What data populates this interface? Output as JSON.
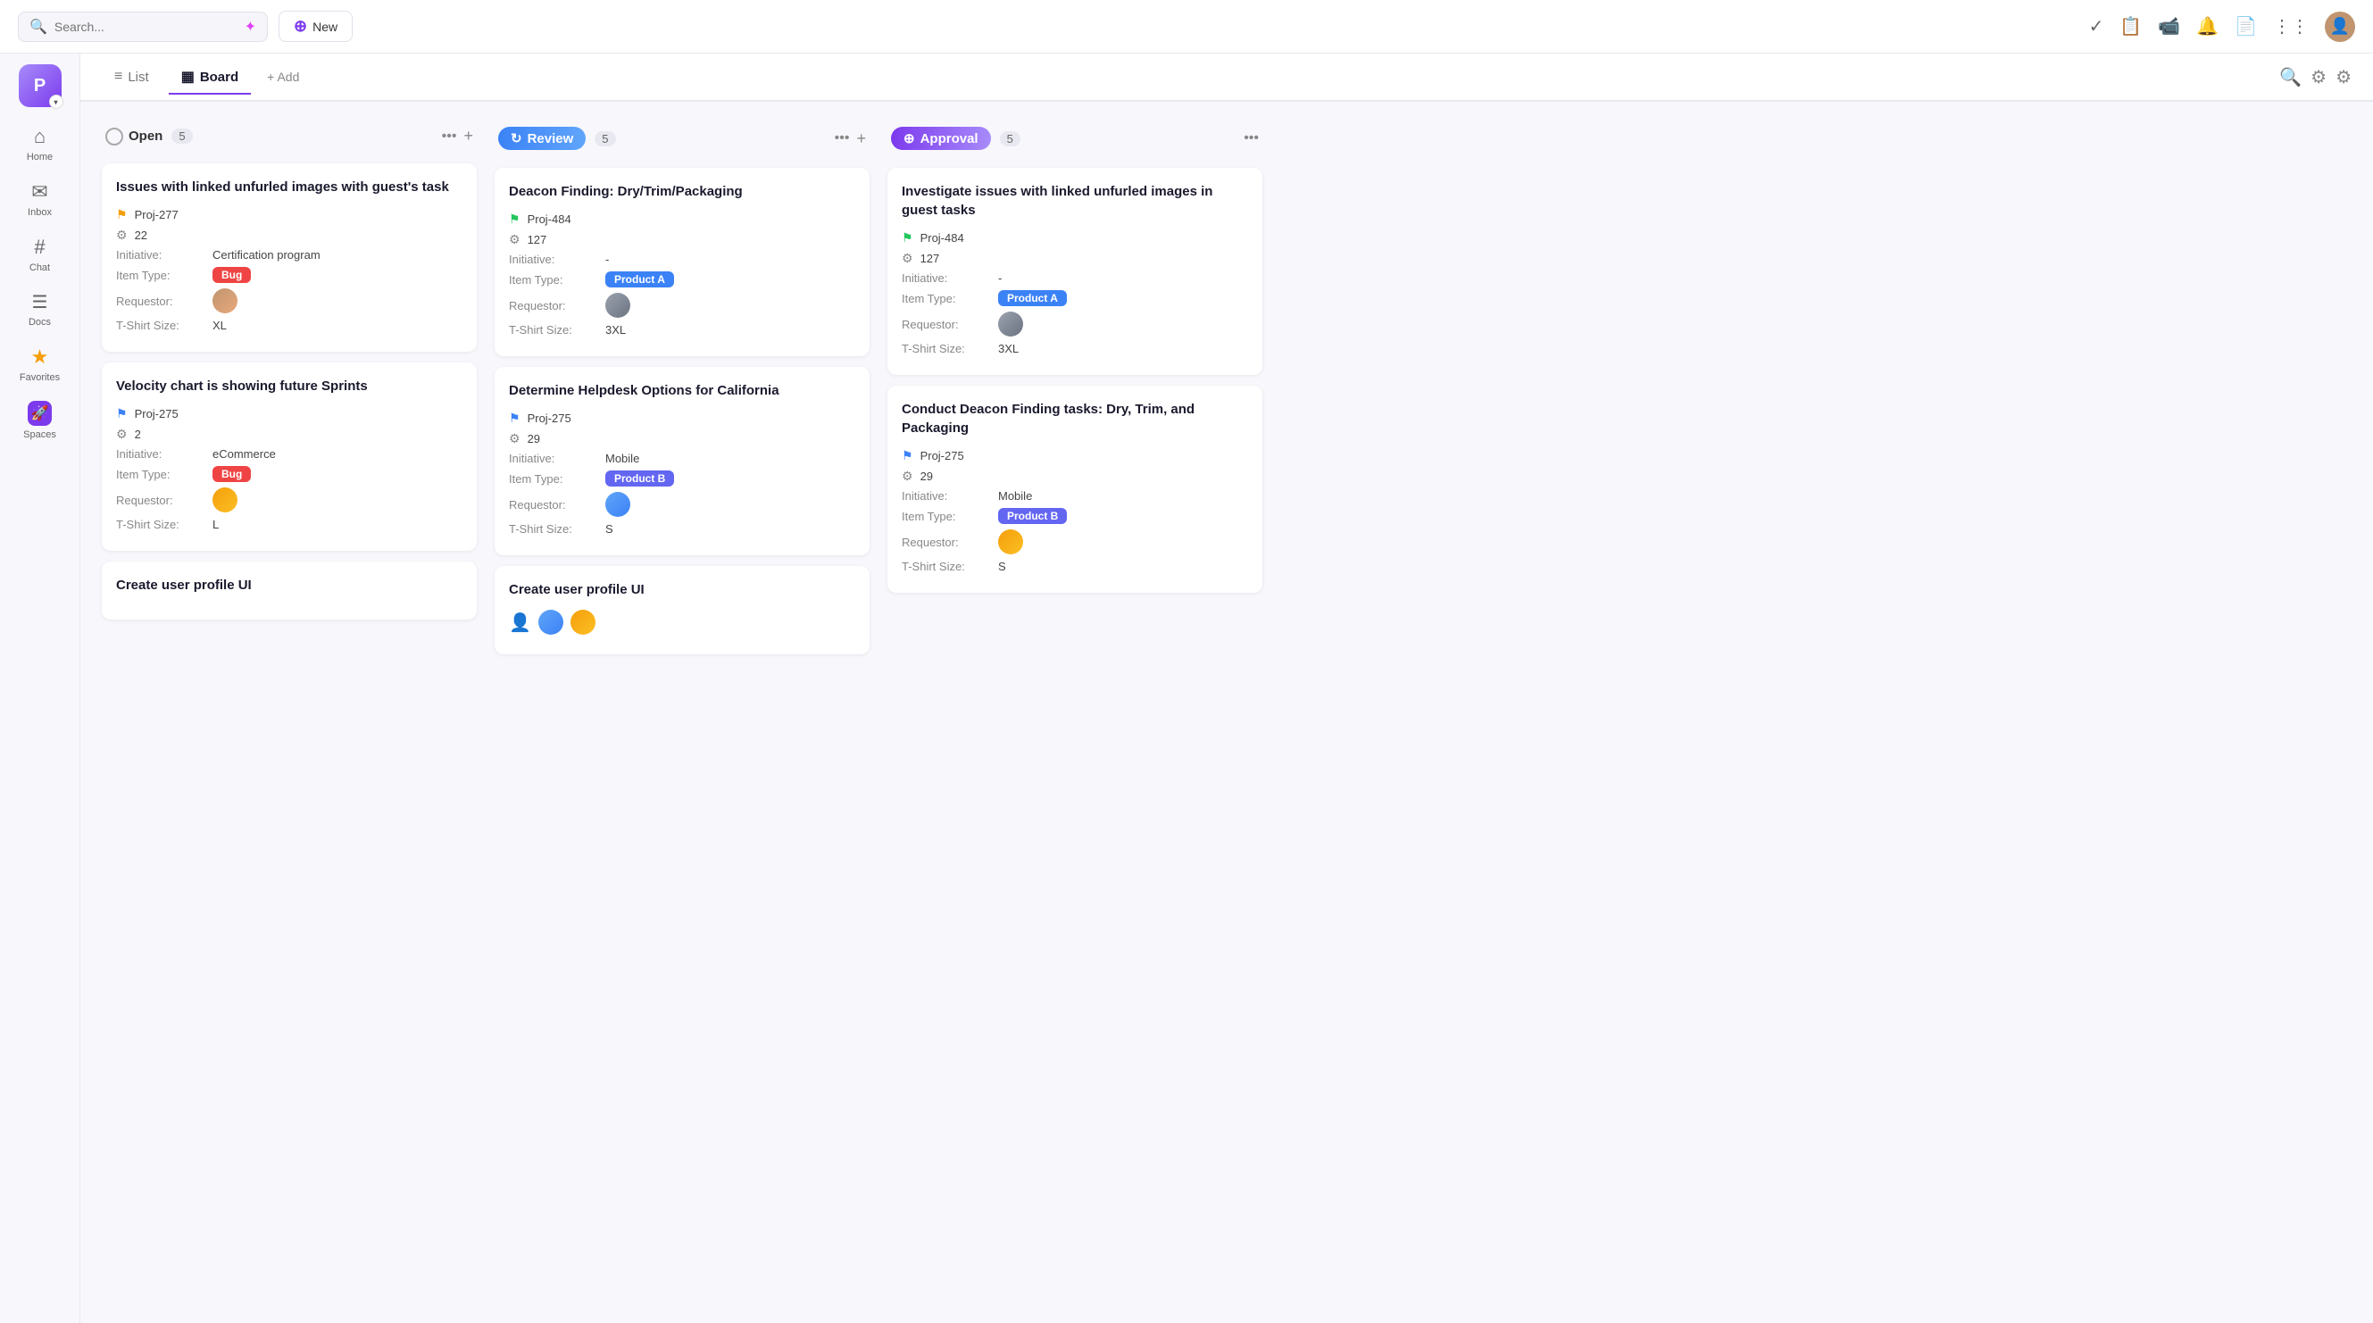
{
  "topbar": {
    "search_placeholder": "Search...",
    "new_label": "New"
  },
  "sidebar": {
    "workspace_label": "P",
    "items": [
      {
        "id": "home",
        "label": "Home",
        "icon": "⌂"
      },
      {
        "id": "inbox",
        "label": "Inbox",
        "icon": "✉"
      },
      {
        "id": "chat",
        "label": "Chat",
        "icon": "#"
      },
      {
        "id": "docs",
        "label": "Docs",
        "icon": "☰"
      },
      {
        "id": "favorites",
        "label": "Favorites",
        "icon": "★"
      },
      {
        "id": "spaces",
        "label": "Spaces",
        "icon": "🚀"
      }
    ]
  },
  "subheader": {
    "tabs": [
      {
        "id": "list",
        "label": "List",
        "icon": "≡"
      },
      {
        "id": "board",
        "label": "Board",
        "icon": "▦"
      }
    ],
    "add_label": "+ Add"
  },
  "columns": [
    {
      "id": "open",
      "name": "Open",
      "count": 5,
      "type": "open",
      "cards": [
        {
          "title": "Issues with linked unfurled images with guest's task",
          "flag_type": "yellow",
          "project": "Proj-277",
          "points": "22",
          "initiative": "Certification program",
          "item_type": "Bug",
          "item_type_class": "badge-bug",
          "requestor": "person1",
          "tshirt": "XL"
        },
        {
          "title": "Velocity chart is showing future Sprints",
          "flag_type": "blue",
          "project": "Proj-275",
          "points": "2",
          "initiative": "eCommerce",
          "item_type": "Bug",
          "item_type_class": "badge-bug",
          "requestor": "person3",
          "tshirt": "L"
        },
        {
          "title": "Create user profile UI",
          "flag_type": "none",
          "project": "",
          "points": "",
          "initiative": "",
          "item_type": "",
          "item_type_class": "",
          "requestor": "",
          "tshirt": ""
        }
      ]
    },
    {
      "id": "review",
      "name": "Review",
      "count": 5,
      "type": "review",
      "cards": [
        {
          "title": "Deacon Finding: Dry/Trim/Packaging",
          "flag_type": "green",
          "project": "Proj-484",
          "points": "127",
          "initiative": "-",
          "item_type": "Product A",
          "item_type_class": "badge-product-a",
          "requestor": "person4",
          "tshirt": "3XL"
        },
        {
          "title": "Determine Helpdesk Options for California",
          "flag_type": "blue",
          "project": "Proj-275",
          "points": "29",
          "initiative": "Mobile",
          "item_type": "Product B",
          "item_type_class": "badge-product-b",
          "requestor": "person2",
          "tshirt": "S"
        },
        {
          "title": "Create user profile UI",
          "flag_type": "none",
          "project": "",
          "points": "",
          "initiative": "",
          "item_type": "",
          "item_type_class": "",
          "requestor": "multi",
          "tshirt": ""
        }
      ]
    },
    {
      "id": "approval",
      "name": "Approval",
      "count": 5,
      "type": "approval",
      "cards": [
        {
          "title": "Investigate issues with linked unfurled images in guest tasks",
          "flag_type": "green",
          "project": "Proj-484",
          "points": "127",
          "initiative": "-",
          "item_type": "Product A",
          "item_type_class": "badge-product-a",
          "requestor": "person4",
          "tshirt": "3XL"
        },
        {
          "title": "Conduct Deacon Finding tasks: Dry, Trim, and Packaging",
          "flag_type": "blue",
          "project": "Proj-275",
          "points": "29",
          "initiative": "Mobile",
          "item_type": "Product B",
          "item_type_class": "badge-product-b",
          "requestor": "person3",
          "tshirt": "S"
        }
      ]
    }
  ]
}
